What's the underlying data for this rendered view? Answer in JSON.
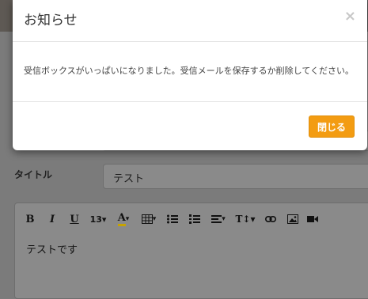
{
  "form": {
    "title_label": "タイトル",
    "title_value": "テスト",
    "editor_body": "テストです"
  },
  "toolbar": {
    "bold": "B",
    "italic": "I",
    "underline": "U",
    "font_size": "13▾",
    "font_color": "A",
    "dropdown_caret": "▾",
    "text_style": "T↕▾"
  },
  "modal": {
    "title": "お知らせ",
    "close_glyph": "×",
    "message": "受信ボックスがいっぱいになりました。受信メールを保存するか削除してください。",
    "close_button": "閉じる"
  },
  "colors": {
    "accent_button": "#f39c12",
    "font_color_underline": "#c7a300"
  }
}
